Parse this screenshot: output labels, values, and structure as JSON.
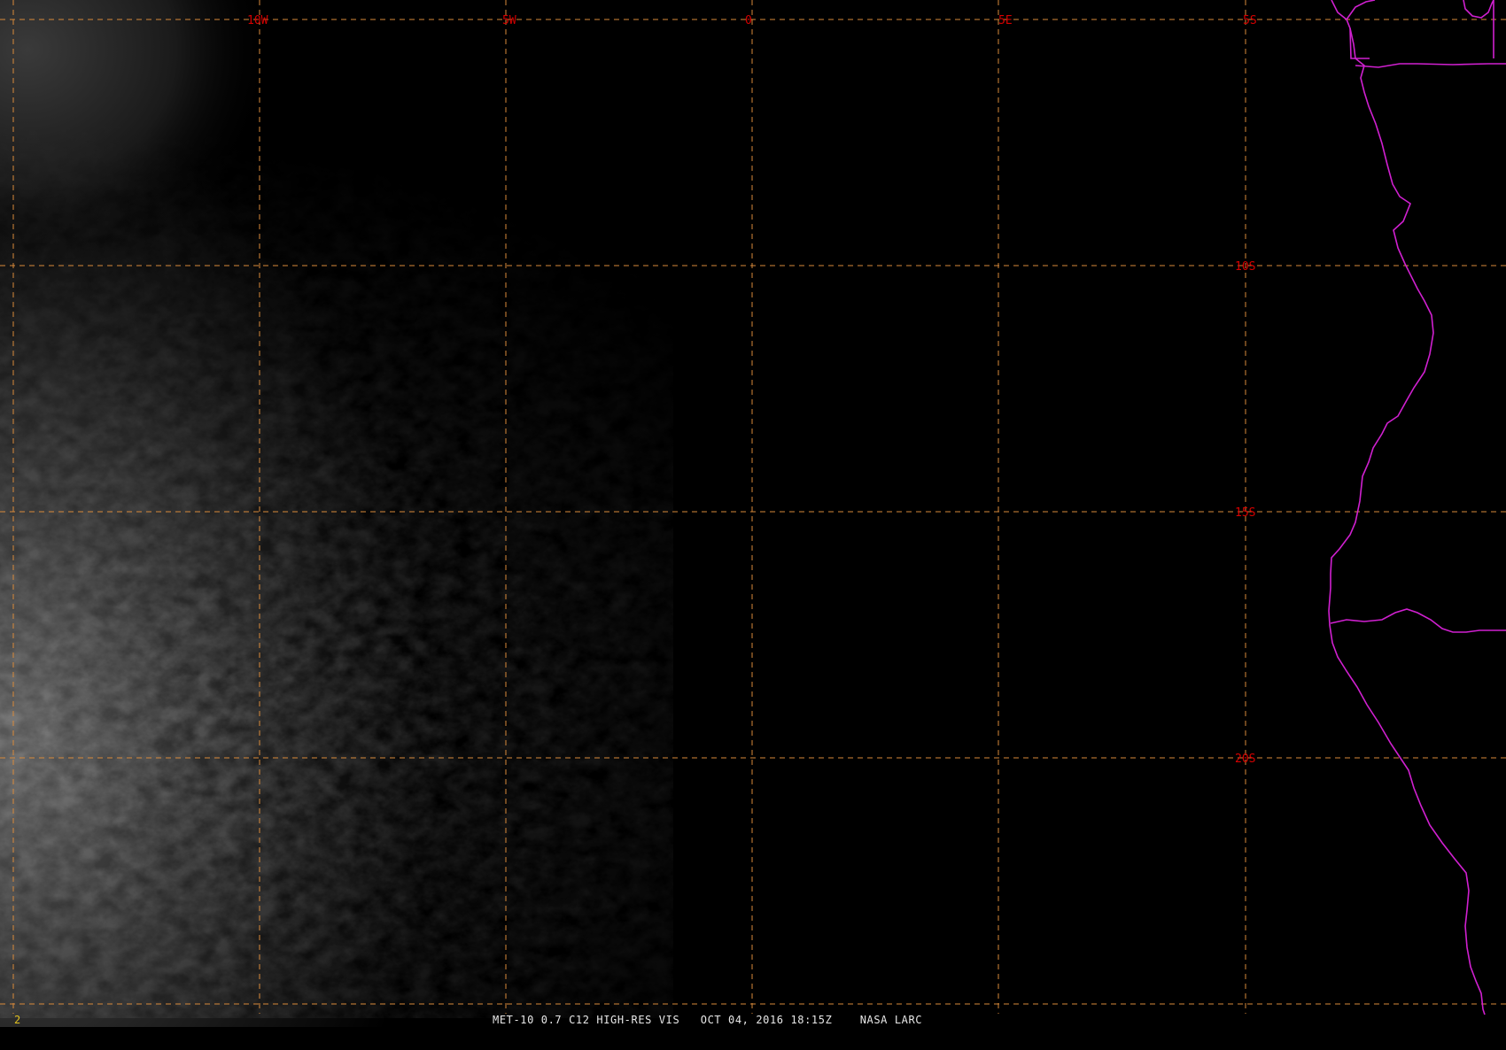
{
  "image": {
    "frame_number": "2",
    "caption": "MET-10 0.7 C12 HIGH-RES VIS   OCT 04, 2016 18:15Z    NASA LARC"
  },
  "grid": {
    "longitude_labels": [
      "10W",
      "5W",
      "0",
      "5E"
    ],
    "latitude_labels": [
      "5S",
      "10S",
      "15S",
      "20S"
    ],
    "line_color": "#d98a3a",
    "label_color": "#d60000"
  },
  "overlay": {
    "coastline_color": "#d020d0"
  }
}
